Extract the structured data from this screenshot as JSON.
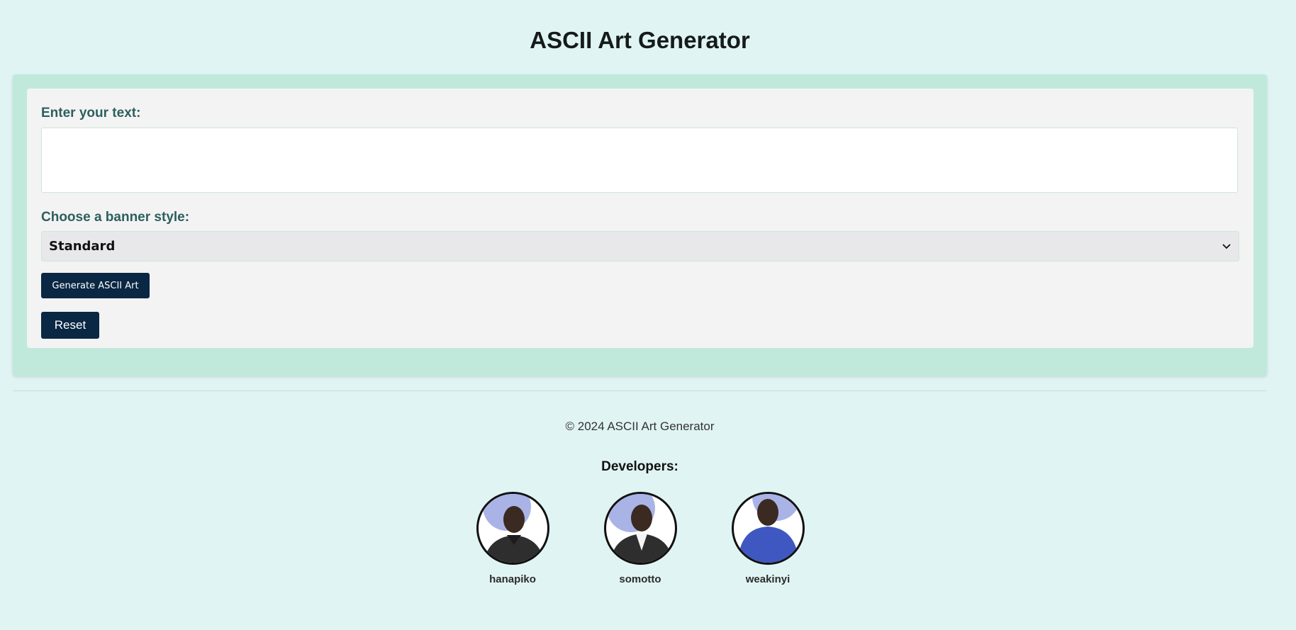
{
  "header": {
    "title": "ASCII Art Generator"
  },
  "form": {
    "text_label": "Enter your text:",
    "text_value": "",
    "style_label": "Choose a banner style:",
    "style_selected": "Standard",
    "generate_label": "Generate ASCII Art",
    "reset_label": "Reset"
  },
  "footer": {
    "copyright": "© 2024 ASCII Art Generator",
    "developers_heading": "Developers:",
    "developers": [
      {
        "name": "hanapiko",
        "hoodie_color": "#2e2e2e"
      },
      {
        "name": "somotto",
        "hoodie_color": "#2e2e2e"
      },
      {
        "name": "weakinyi",
        "hoodie_color": "#3f57c0"
      }
    ]
  },
  "colors": {
    "page_bg": "#e0f4f3",
    "panel_bg": "#c0e9dc",
    "card_bg": "#f3f3f3",
    "label": "#2c5f5e",
    "button_bg": "#0a2744"
  }
}
